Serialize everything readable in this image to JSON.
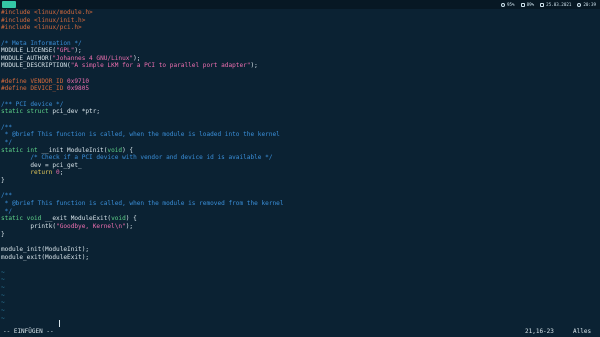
{
  "topbar": {
    "workspace": "",
    "tray": [
      {
        "icon": "network-icon",
        "text": "95%"
      },
      {
        "icon": "battery-icon",
        "text": "89%"
      },
      {
        "icon": "calendar-icon",
        "text": "25.03.2021"
      },
      {
        "icon": "clock-icon",
        "text": "20:39"
      }
    ]
  },
  "editor": {
    "lines": [
      [
        [
          "t-pre",
          "#include <linux/module.h>"
        ]
      ],
      [
        [
          "t-pre",
          "#include <linux/init.h>"
        ]
      ],
      [
        [
          "t-pre",
          "#include <linux/pci.h>"
        ]
      ],
      [],
      [
        [
          "t-cmt",
          "/* Meta Information */"
        ]
      ],
      [
        [
          "t-id",
          "MODULE_LICENSE("
        ],
        [
          "t-str",
          "\"GPL\""
        ],
        [
          "t-id",
          ");"
        ]
      ],
      [
        [
          "t-id",
          "MODULE_AUTHOR("
        ],
        [
          "t-str",
          "\"Johannes 4 GNU/Linux\""
        ],
        [
          "t-id",
          ");"
        ]
      ],
      [
        [
          "t-id",
          "MODULE_DESCRIPTION("
        ],
        [
          "t-str",
          "\"A simple LKM for a PCI to parallel port adapter\""
        ],
        [
          "t-id",
          ");"
        ]
      ],
      [],
      [
        [
          "t-pre",
          "#define VENDOR_ID "
        ],
        [
          "t-num",
          "0x9710"
        ]
      ],
      [
        [
          "t-pre",
          "#define DEVICE_ID "
        ],
        [
          "t-num",
          "0x9805"
        ]
      ],
      [],
      [
        [
          "t-cmt",
          "/** PCI device */"
        ]
      ],
      [
        [
          "t-type",
          "static struct "
        ],
        [
          "t-id",
          "pci_dev *ptr;"
        ]
      ],
      [],
      [
        [
          "t-cmt",
          "/**"
        ]
      ],
      [
        [
          "t-cmt",
          " * @brief This function is called, when the module is loaded into the kernel"
        ]
      ],
      [
        [
          "t-cmt",
          " */"
        ]
      ],
      [
        [
          "t-type",
          "static int "
        ],
        [
          "t-id",
          "__init ModuleInit("
        ],
        [
          "t-type",
          "void"
        ],
        [
          "t-id",
          ") {"
        ]
      ],
      [
        [
          "t-cmt",
          "        /* Check if a PCI device with vendor and device id is available */"
        ]
      ],
      [
        [
          "t-id",
          "        dev = pci_get_"
        ]
      ],
      [
        [
          "t-kw",
          "        return "
        ],
        [
          "t-num",
          "0"
        ],
        [
          "t-id",
          ";"
        ]
      ],
      [
        [
          "t-id",
          "}"
        ]
      ],
      [],
      [
        [
          "t-cmt",
          "/**"
        ]
      ],
      [
        [
          "t-cmt",
          " * @brief This function is called, when the module is removed from the kernel"
        ]
      ],
      [
        [
          "t-cmt",
          " */"
        ]
      ],
      [
        [
          "t-type",
          "static void "
        ],
        [
          "t-id",
          "__exit ModuleExit("
        ],
        [
          "t-type",
          "void"
        ],
        [
          "t-id",
          ") {"
        ]
      ],
      [
        [
          "t-id",
          "        printk("
        ],
        [
          "t-str",
          "\"Goodbye, Kernel\\n\""
        ],
        [
          "t-id",
          ");"
        ]
      ],
      [
        [
          "t-id",
          "}"
        ]
      ],
      [],
      [
        [
          "t-id",
          "module_init(ModuleInit);"
        ]
      ],
      [
        [
          "t-id",
          "module_exit(ModuleExit);"
        ]
      ],
      [],
      [
        [
          "tilde",
          "~"
        ]
      ],
      [
        [
          "tilde",
          "~"
        ]
      ],
      [
        [
          "tilde",
          "~"
        ]
      ],
      [
        [
          "tilde",
          "~"
        ]
      ],
      [
        [
          "tilde",
          "~"
        ]
      ],
      [
        [
          "tilde",
          "~"
        ]
      ],
      [
        [
          "tilde",
          "~"
        ]
      ]
    ]
  },
  "statusline": {
    "mode": "-- EINFÜGEN --",
    "position": "21,16-23",
    "scroll": "Alles"
  }
}
